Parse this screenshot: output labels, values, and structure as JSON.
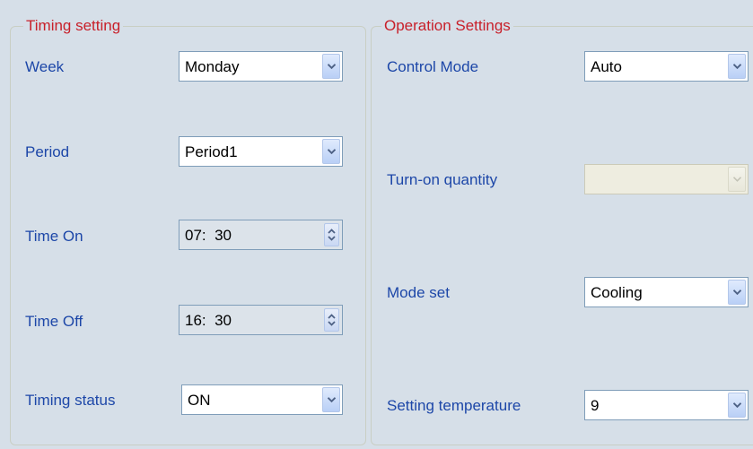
{
  "timing": {
    "title": "Timing setting",
    "week": {
      "label": "Week",
      "value": "Monday"
    },
    "period": {
      "label": "Period",
      "value": "Period1"
    },
    "time_on": {
      "label": "Time On",
      "value": "07:  30"
    },
    "time_off": {
      "label": "Time Off",
      "value": "16:  30"
    },
    "status": {
      "label": "Timing status",
      "value": "ON"
    }
  },
  "operation": {
    "title": "Operation Settings",
    "control_mode": {
      "label": "Control Mode",
      "value": "Auto"
    },
    "turn_on_quantity": {
      "label": "Turn-on quantity",
      "value": ""
    },
    "mode_set": {
      "label": "Mode set",
      "value": "Cooling"
    },
    "setting_temperature": {
      "label": "Setting temperature",
      "value": "9"
    }
  },
  "icons": {
    "dropdown": "chevron-down-icon",
    "spinner": "up-down-arrows-icon"
  },
  "colors": {
    "legend": "#c8202a",
    "label": "#1d47a8",
    "background": "#d6dfe8"
  }
}
